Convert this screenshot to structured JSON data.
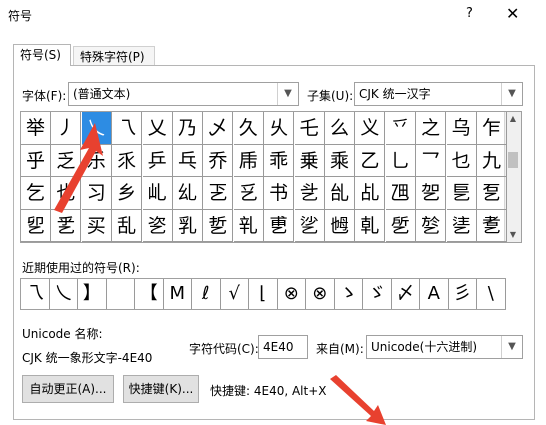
{
  "window": {
    "title": "符号",
    "help": "?",
    "close": "✕"
  },
  "tabs": [
    {
      "label": "符号(S)"
    },
    {
      "label": "特殊字符(P)"
    }
  ],
  "font": {
    "label": "字体(F):",
    "value": "(普通文本)"
  },
  "subset": {
    "label": "子集(U):",
    "value": "CJK 统一汉字"
  },
  "symbols": [
    [
      "举",
      "丿",
      "乀",
      "乁",
      "乂",
      "乃",
      "乄",
      "久",
      "乆",
      "乇",
      "么",
      "义",
      "乊",
      "之",
      "乌",
      "乍"
    ],
    [
      "乎",
      "乏",
      "乐",
      "乑",
      "乒",
      "乓",
      "乔",
      "乕",
      "乖",
      "乗",
      "乘",
      "乙",
      "乚",
      "乛",
      "乜",
      "九"
    ],
    [
      "乞",
      "也",
      "习",
      "乡",
      "乢",
      "乣",
      "乤",
      "乥",
      "书",
      "乧",
      "乨",
      "乩",
      "乪",
      "乫",
      "乬",
      "乭"
    ],
    [
      "乮",
      "乯",
      "买",
      "乱",
      "乲",
      "乳",
      "乴",
      "乵",
      "乶",
      "乷",
      "乸",
      "乹",
      "乺",
      "乻",
      "乼",
      "乽"
    ]
  ],
  "selected": {
    "row": 0,
    "col": 2
  },
  "recent": {
    "label": "近期使用过的符号(R):",
    "items": [
      "乁",
      "乀",
      "】",
      "",
      "【",
      "M",
      "ℓ",
      "√",
      "⌊",
      "⊗",
      "⊗",
      "ゝ",
      "ゞ",
      "〆",
      "A",
      "彡",
      "\\"
    ]
  },
  "unicode_name": {
    "label": "Unicode 名称:",
    "value": "CJK 统一象形文字-4E40"
  },
  "char_code": {
    "label": "字符代码(C):",
    "value": "4E40"
  },
  "from": {
    "label": "来自(M):",
    "value": "Unicode(十六进制)"
  },
  "buttons": {
    "autocorrect": "自动更正(A)...",
    "shortcut_key": "快捷键(K)..."
  },
  "shortcut_text": "快捷键: 4E40, Alt+X",
  "colors": {
    "selected_bg": "#2d8ce3",
    "annotation_arrow": "#e8412f"
  }
}
